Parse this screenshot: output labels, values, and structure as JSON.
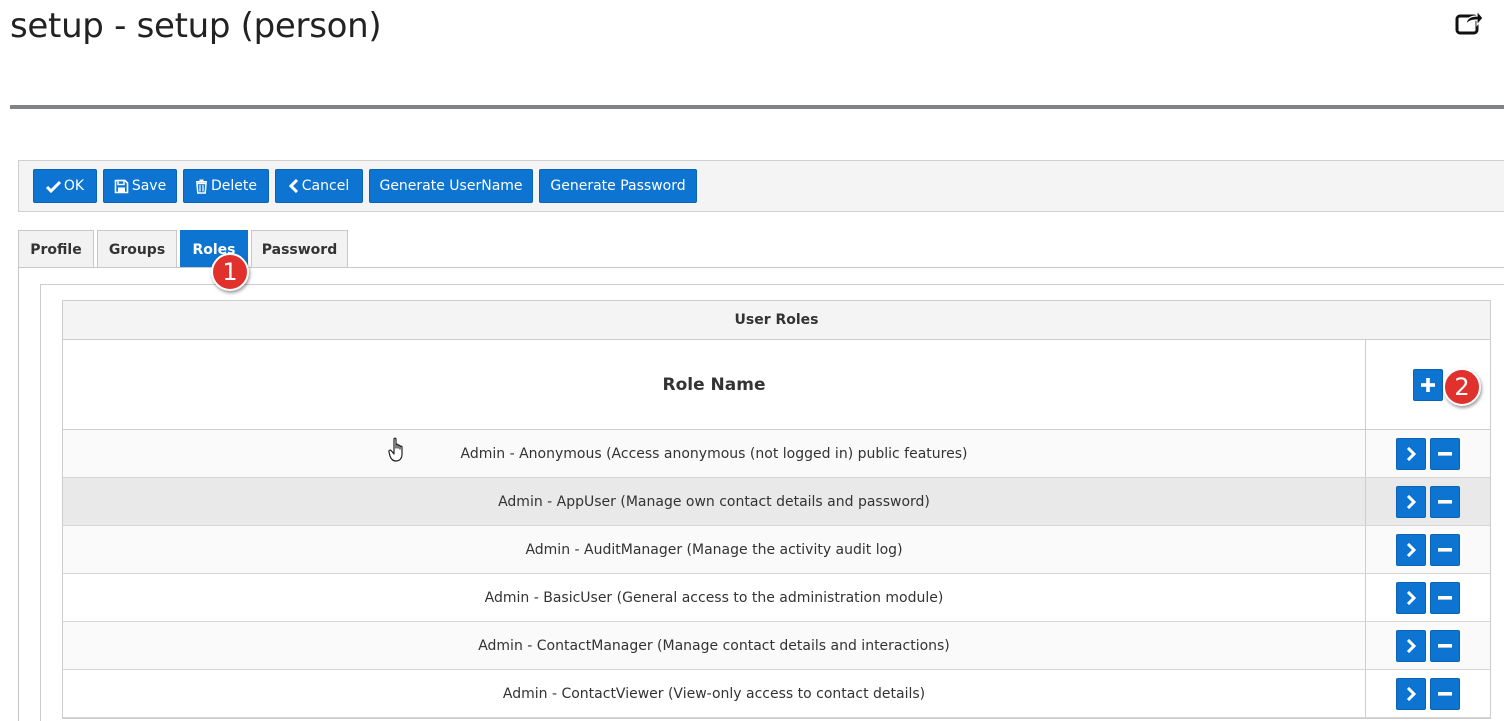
{
  "header": {
    "title": "setup - setup (person)"
  },
  "toolbar": {
    "ok_label": "OK",
    "save_label": "Save",
    "delete_label": "Delete",
    "cancel_label": "Cancel",
    "generate_username_label": "Generate UserName",
    "generate_password_label": "Generate Password"
  },
  "tabs": [
    {
      "label": "Profile",
      "active": false
    },
    {
      "label": "Groups",
      "active": false
    },
    {
      "label": "Roles",
      "active": true
    },
    {
      "label": "Password",
      "active": false
    }
  ],
  "annotations": {
    "badge1": "1",
    "badge2": "2"
  },
  "grid": {
    "caption": "User Roles",
    "column_header": "Role Name",
    "rows": [
      {
        "name": "Admin - Anonymous (Access anonymous (not logged in) public features)"
      },
      {
        "name": "Admin - AppUser (Manage own contact details and password)"
      },
      {
        "name": "Admin - AuditManager (Manage the activity audit log)"
      },
      {
        "name": "Admin - BasicUser (General access to the administration module)"
      },
      {
        "name": "Admin - ContactManager (Manage contact details and interactions)"
      },
      {
        "name": "Admin - ContactViewer (View-only access to contact details)"
      }
    ]
  },
  "icons": {
    "share": "share-icon",
    "ok": "check-icon",
    "save": "floppy-disk-icon",
    "delete": "trash-icon",
    "cancel": "chevron-left-icon",
    "add": "plus-icon",
    "open": "chevron-right-icon",
    "remove": "minus-icon"
  },
  "colors": {
    "accent": "#0d74d1",
    "badge": "#e0312d",
    "rule": "#7f8387"
  }
}
